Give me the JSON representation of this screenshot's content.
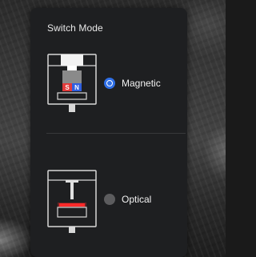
{
  "panel": {
    "title": "Switch Mode"
  },
  "options": [
    {
      "label": "Magnetic",
      "selected": true,
      "icon": "magnetic-switch-icon",
      "pole_left": "S",
      "pole_right": "N"
    },
    {
      "label": "Optical",
      "selected": false,
      "icon": "optical-switch-icon"
    }
  ],
  "colors": {
    "panel_bg": "#1e1f21",
    "accent": "#2f6fe6",
    "radio_off": "#5c5c5e",
    "pole_s": "#e23b3b",
    "pole_n": "#2f5fe0",
    "optical_light": "#ff2a2a"
  }
}
